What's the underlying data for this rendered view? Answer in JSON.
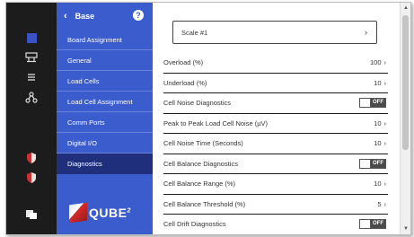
{
  "sidebar": {
    "back_label": "Base",
    "help_glyph": "?",
    "items": [
      {
        "label": "Board Assignment",
        "active": false
      },
      {
        "label": "General",
        "active": false
      },
      {
        "label": "Load Cells",
        "active": false
      },
      {
        "label": "Load Cell Assignment",
        "active": false
      },
      {
        "label": "Comm Ports",
        "active": false
      },
      {
        "label": "Digital I/O",
        "active": false
      },
      {
        "label": "Diagnostics",
        "active": true
      }
    ],
    "logo_text": "QUBE",
    "logo_sup": "2"
  },
  "rail": {
    "icons": [
      "square-icon",
      "network-icon",
      "list-icon",
      "hierarchy-icon",
      "shield-icon",
      "shield-icon",
      "cube-icon"
    ]
  },
  "main": {
    "scale_button": {
      "label": "Scale #1",
      "arrow": "›"
    },
    "rows": [
      {
        "label": "Overload (%)",
        "type": "value",
        "value": "100"
      },
      {
        "label": "Underload (%)",
        "type": "value",
        "value": "10"
      },
      {
        "label": "Cell Noise Diagnostics",
        "type": "toggle",
        "value": "OFF"
      },
      {
        "label": "Peak to Peak Load Cell Noise (µV)",
        "type": "value",
        "value": "10"
      },
      {
        "label": "Cell Noise Time (Seconds)",
        "type": "value",
        "value": "10"
      },
      {
        "label": "Cell Balance Diagnostics",
        "type": "toggle",
        "value": "OFF"
      },
      {
        "label": "Cell Balance Range (%)",
        "type": "value",
        "value": "10"
      },
      {
        "label": "Cell Balance Threshold (%)",
        "type": "value",
        "value": "5"
      },
      {
        "label": "Cell Drift Diagnostics",
        "type": "toggle",
        "value": "OFF"
      }
    ]
  },
  "colors": {
    "sidebar_bg": "#3b5ccc",
    "sidebar_active": "#1f2f7c",
    "rail_bg": "#1c1c1c"
  }
}
